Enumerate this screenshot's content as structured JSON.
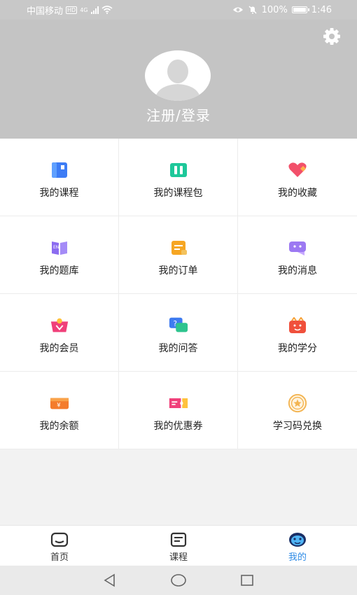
{
  "status_bar": {
    "carrier": "中国移动",
    "hd": "HD",
    "network": "4G",
    "battery": "100%",
    "time": "1:46"
  },
  "header": {
    "login_label": "注册/登录",
    "settings_icon": "gear-icon",
    "avatar_icon": "default-avatar-icon",
    "background_color": "#c4c4c4"
  },
  "menu": {
    "items": [
      {
        "label": "我的课程",
        "icon": "course-book-icon",
        "color": "#3d7cf5"
      },
      {
        "label": "我的课程包",
        "icon": "course-package-icon",
        "color": "#1ec89a"
      },
      {
        "label": "我的收藏",
        "icon": "heart-icon",
        "color": "#f2506a"
      },
      {
        "label": "我的题库",
        "icon": "question-bank-icon",
        "color": "#8b6cf0"
      },
      {
        "label": "我的订单",
        "icon": "order-icon",
        "color": "#f6a623"
      },
      {
        "label": "我的消息",
        "icon": "message-icon",
        "color": "#9c79f2"
      },
      {
        "label": "我的会员",
        "icon": "membership-icon",
        "color": "#f0407a"
      },
      {
        "label": "我的问答",
        "icon": "qa-icon",
        "color": "#3e7bf0"
      },
      {
        "label": "我的学分",
        "icon": "credit-icon",
        "color": "#f0503c"
      },
      {
        "label": "我的余额",
        "icon": "balance-icon",
        "color": "#f47c2c"
      },
      {
        "label": "我的优惠券",
        "icon": "coupon-icon",
        "color": "#f0407a"
      },
      {
        "label": "学习码兑换",
        "icon": "star-coin-icon",
        "color": "#f3b451"
      }
    ]
  },
  "tabbar": {
    "tabs": [
      {
        "label": "首页",
        "icon": "home-icon"
      },
      {
        "label": "课程",
        "icon": "course-icon"
      },
      {
        "label": "我的",
        "icon": "profile-face-icon"
      }
    ],
    "active_index": 2,
    "active_color": "#2e8be6"
  },
  "system_nav": {
    "icons": [
      "back-icon",
      "home-circle-icon",
      "recents-icon"
    ]
  }
}
